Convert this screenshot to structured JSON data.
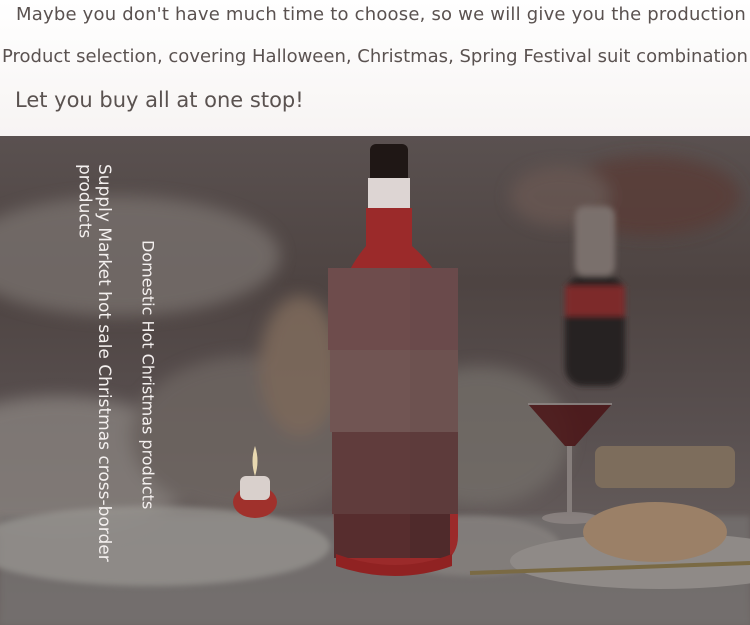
{
  "header": {
    "line1": "Maybe you don't have much time to choose, so we will give you the production",
    "line2": "Product selection, covering Halloween, Christmas, Spring Festival suit combination",
    "line3": "Let you buy all at one stop!"
  },
  "photo": {
    "caption_main": "Supply Market hot sale Christmas cross-border products",
    "caption_secondary": "Domestic Hot Christmas products"
  },
  "colors": {
    "text_dark": "#5a5250",
    "overlay": "#4e4442",
    "bottle_sleeve": "#9b2a2a"
  }
}
